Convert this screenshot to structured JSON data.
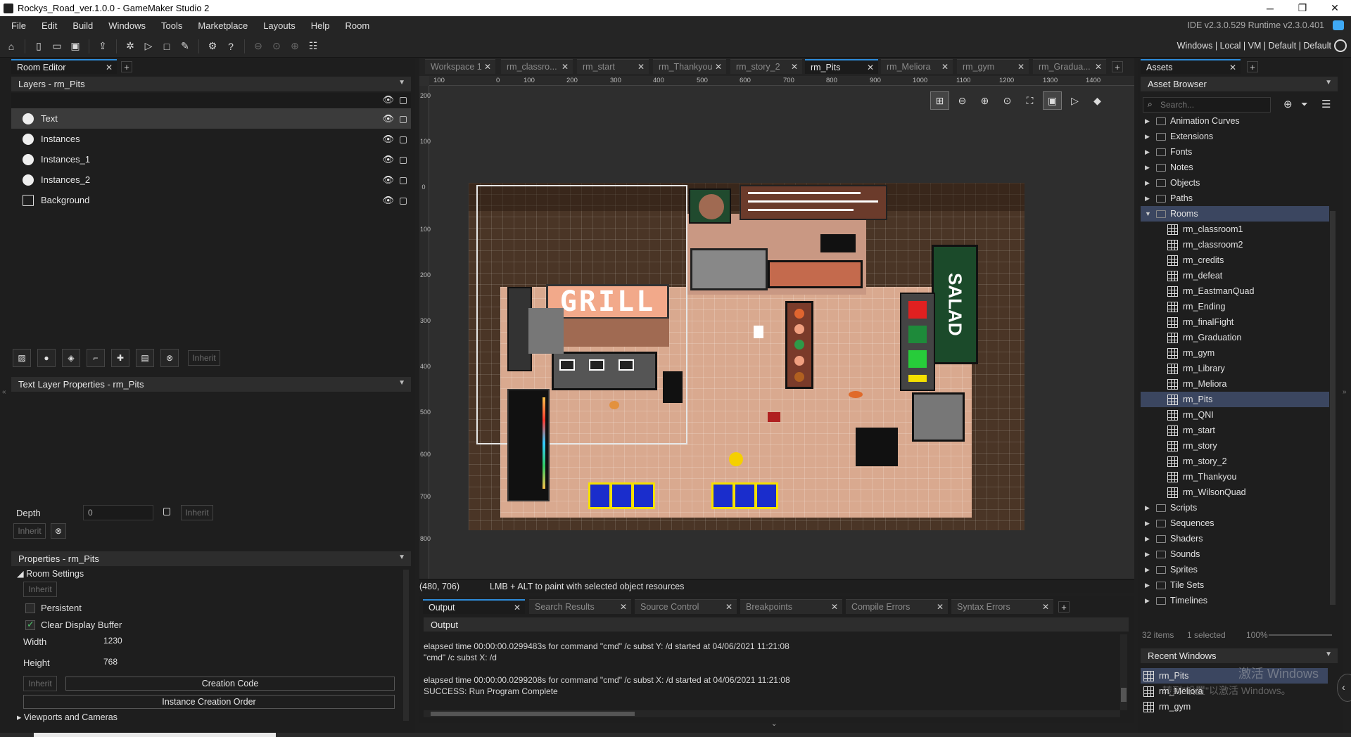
{
  "window": {
    "title": "Rockys_Road_ver.1.0.0 - GameMaker Studio 2"
  },
  "menu": [
    "File",
    "Edit",
    "Build",
    "Windows",
    "Tools",
    "Marketplace",
    "Layouts",
    "Help",
    "Room"
  ],
  "version_text": "IDE v2.3.0.529  Runtime v2.3.0.401",
  "target_text": "Windows  |  Local  |  VM  |  Default  |  Default",
  "left": {
    "tab": "Room Editor",
    "layers_header": "Layers - rm_Pits",
    "layers": [
      "Text",
      "Instances",
      "Instances_1",
      "Instances_2",
      "Background"
    ],
    "inherit": "Inherit",
    "layer_props_header": "Text Layer Properties - rm_Pits",
    "depth_label": "Depth",
    "depth_value": "0",
    "props_header": "Properties - rm_Pits",
    "room_settings": "Room Settings",
    "persistent": "Persistent",
    "clear_display": "Clear Display Buffer",
    "width_label": "Width",
    "width_value": "1230",
    "height_label": "Height",
    "height_value": "768",
    "creation_code": "Creation Code",
    "instance_order": "Instance Creation Order",
    "viewports": "Viewports and Cameras"
  },
  "doc_tabs": [
    "Workspace 1",
    "rm_classro...",
    "rm_start",
    "rm_Thankyou",
    "rm_story_2",
    "rm_Pits",
    "rm_Meliora",
    "rm_gym",
    "rm_Gradua..."
  ],
  "ruler": [
    "100",
    "0",
    "100",
    "200",
    "300",
    "400",
    "500",
    "600",
    "700",
    "800",
    "900",
    "1000",
    "1100",
    "1200",
    "1300",
    "1400"
  ],
  "canvas_sign": "GRILL",
  "status": {
    "coords": "(480, 706)",
    "hint": "LMB + ALT to paint with selected object resources"
  },
  "output": {
    "tabs": [
      "Output",
      "Search Results",
      "Source Control",
      "Breakpoints",
      "Compile Errors",
      "Syntax Errors"
    ],
    "title": "Output",
    "lines": [
      "elapsed time 00:00:00.0299483s for command \"cmd\" /c subst Y: /d started at 04/06/2021 11:21:08",
      "\"cmd\"  /c subst X: /d",
      "",
      "elapsed time 00:00:00.0299208s for command \"cmd\" /c subst X: /d started at 04/06/2021 11:21:08",
      "SUCCESS: Run Program Complete"
    ]
  },
  "assets": {
    "tab": "Assets",
    "browser": "Asset Browser",
    "search_placeholder": "Search...",
    "folders_top": [
      "Animation Curves",
      "Extensions",
      "Fonts",
      "Notes",
      "Objects",
      "Paths",
      "Rooms"
    ],
    "rooms": [
      "rm_classroom1",
      "rm_classroom2",
      "rm_credits",
      "rm_defeat",
      "rm_EastmanQuad",
      "rm_Ending",
      "rm_finalFight",
      "rm_Graduation",
      "rm_gym",
      "rm_Library",
      "rm_Meliora",
      "rm_Pits",
      "rm_QNI",
      "rm_start",
      "rm_story",
      "rm_story_2",
      "rm_Thankyou",
      "rm_WilsonQuad"
    ],
    "folders_bottom": [
      "Scripts",
      "Sequences",
      "Shaders",
      "Sounds",
      "Sprites",
      "Tile Sets",
      "Timelines"
    ],
    "footer_items": "32 items",
    "footer_selected": "1 selected",
    "footer_zoom": "100%",
    "recent_header": "Recent Windows",
    "recent": [
      "rm_Pits",
      "rm_Meliora",
      "rm_gym"
    ],
    "watermark1": "激活 Windows",
    "watermark2": "转到\"设置\"以激活 Windows。"
  },
  "colors": {
    "accent": "#2e8bd8",
    "selection": "#3b4660",
    "floor": "#d9a98f",
    "grid_bg": "#4a3526"
  }
}
